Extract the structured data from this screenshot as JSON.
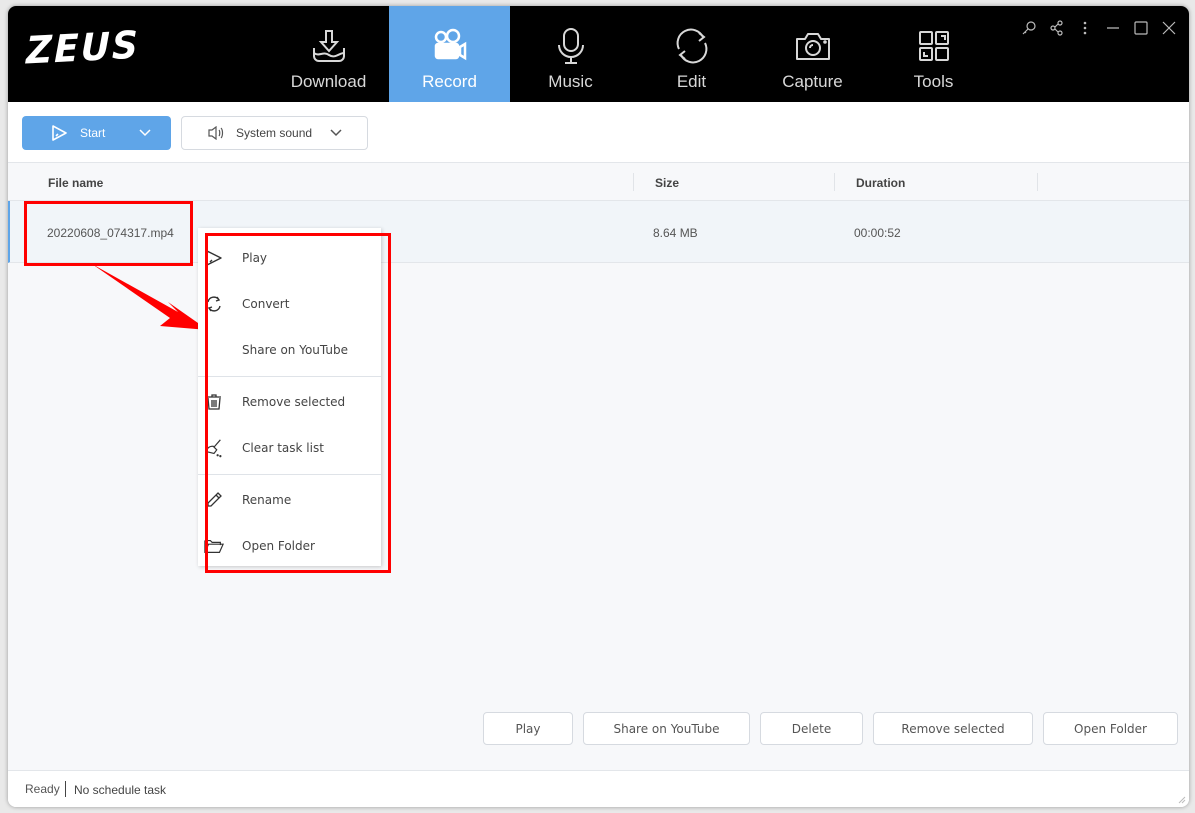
{
  "app": {
    "logo": "ZEUS",
    "accent_color": "#5fa5e8",
    "annotation_color": "#ff0000"
  },
  "nav": {
    "tabs": [
      {
        "label": "Download",
        "icon": "download-icon",
        "active": false
      },
      {
        "label": "Record",
        "icon": "video-camera-icon",
        "active": true
      },
      {
        "label": "Music",
        "icon": "microphone-icon",
        "active": false
      },
      {
        "label": "Edit",
        "icon": "refresh-icon",
        "active": false
      },
      {
        "label": "Capture",
        "icon": "camera-icon",
        "active": false
      },
      {
        "label": "Tools",
        "icon": "grid-icon",
        "active": false
      }
    ]
  },
  "window_controls": [
    "key-icon",
    "share-icon",
    "more-icon",
    "minimize-icon",
    "maximize-icon",
    "close-icon"
  ],
  "toolbar": {
    "start_label": "Start",
    "sound_label": "System sound"
  },
  "table": {
    "headers": {
      "file_name": "File name",
      "size": "Size",
      "duration": "Duration"
    },
    "rows": [
      {
        "file_name": "20220608_074317.mp4",
        "size": "8.64 MB",
        "duration": "00:00:52"
      }
    ]
  },
  "context_menu": {
    "items": [
      {
        "label": "Play",
        "icon": "play-icon"
      },
      {
        "label": "Convert",
        "icon": "convert-icon"
      },
      {
        "label": "Share on YouTube",
        "icon": ""
      },
      {
        "label": "Remove selected",
        "icon": "trash-icon"
      },
      {
        "label": "Clear task list",
        "icon": "broom-icon"
      },
      {
        "label": "Rename",
        "icon": "pencil-icon"
      },
      {
        "label": "Open Folder",
        "icon": "folder-open-icon"
      }
    ]
  },
  "bottom_buttons": {
    "play": "Play",
    "share": "Share on YouTube",
    "delete": "Delete",
    "remove": "Remove selected",
    "open_folder": "Open Folder"
  },
  "status": {
    "ready": "Ready",
    "schedule": "No schedule task"
  }
}
